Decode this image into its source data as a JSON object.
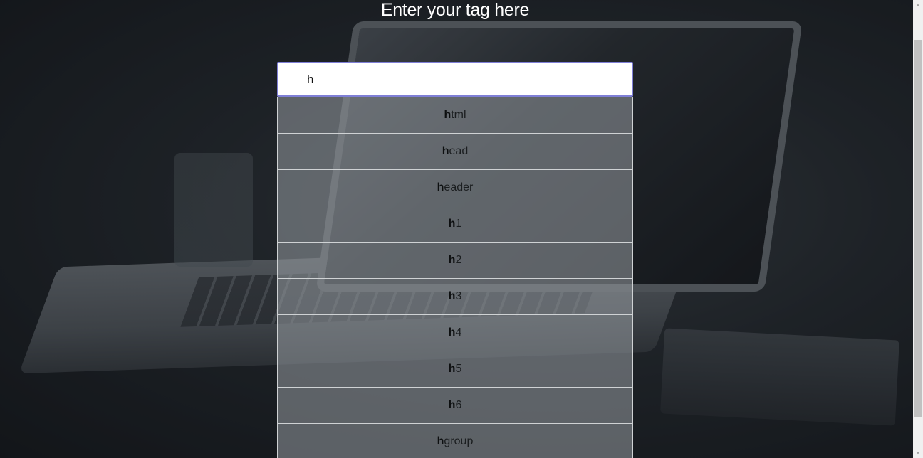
{
  "header": {
    "title": "Enter your tag here"
  },
  "search": {
    "value": "h",
    "placeholder": ""
  },
  "suggestions": [
    {
      "match": "h",
      "rest": "tml"
    },
    {
      "match": "h",
      "rest": "ead"
    },
    {
      "match": "h",
      "rest": "eader"
    },
    {
      "match": "h",
      "rest": "1"
    },
    {
      "match": "h",
      "rest": "2"
    },
    {
      "match": "h",
      "rest": "3"
    },
    {
      "match": "h",
      "rest": "4"
    },
    {
      "match": "h",
      "rest": "5"
    },
    {
      "match": "h",
      "rest": "6"
    },
    {
      "match": "h",
      "rest": "group"
    }
  ],
  "colors": {
    "input_border": "#7f7fd6",
    "suggestion_bg": "rgba(150,155,160,0.55)",
    "title_text": "#ffffff"
  }
}
